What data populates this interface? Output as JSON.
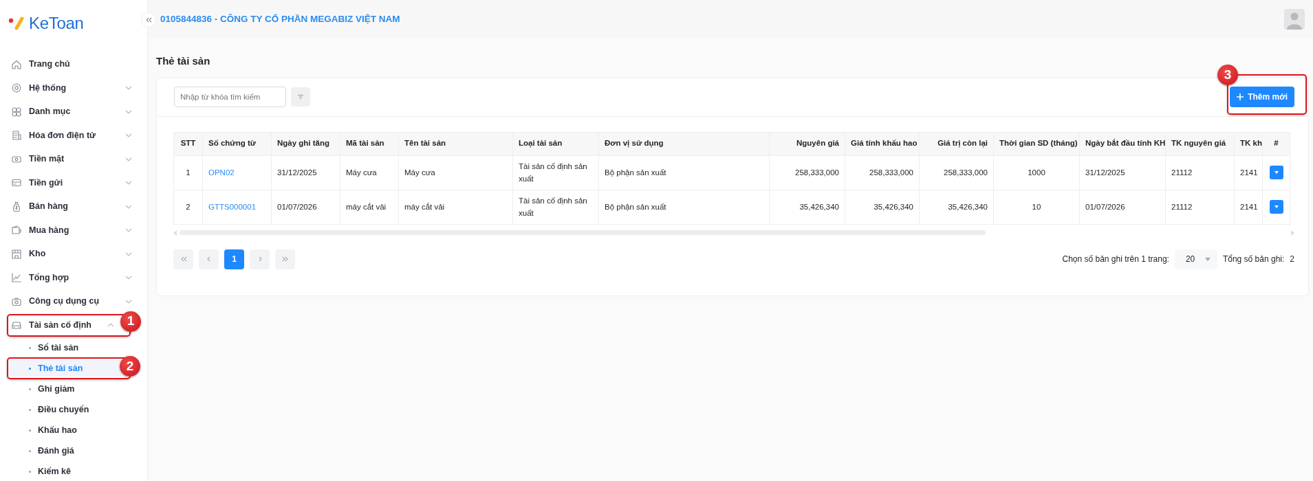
{
  "logo": {
    "text": "KeToan"
  },
  "sidebar": {
    "items": [
      {
        "label": "Trang chủ"
      },
      {
        "label": "Hệ thống",
        "expanded": false
      },
      {
        "label": "Danh mục",
        "expanded": false
      },
      {
        "label": "Hóa đơn điện tử",
        "expanded": false
      },
      {
        "label": "Tiền mặt",
        "expanded": false
      },
      {
        "label": "Tiền gửi",
        "expanded": false
      },
      {
        "label": "Bán hàng",
        "expanded": false
      },
      {
        "label": "Mua hàng",
        "expanded": false
      },
      {
        "label": "Kho",
        "expanded": false
      },
      {
        "label": "Tổng hợp",
        "expanded": false
      },
      {
        "label": "Công cụ dụng cụ",
        "expanded": false
      },
      {
        "label": "Tài sản cố định",
        "expanded": true,
        "annotation": "1",
        "children": [
          {
            "label": "Sổ tài sản",
            "selected": false
          },
          {
            "label": "Thẻ tài sản",
            "selected": true,
            "annotation": "2"
          },
          {
            "label": "Ghi giảm",
            "selected": false
          },
          {
            "label": "Điều chuyển",
            "selected": false
          },
          {
            "label": "Khấu hao",
            "selected": false
          },
          {
            "label": "Đánh giá",
            "selected": false
          },
          {
            "label": "Kiểm kê",
            "selected": false
          }
        ]
      }
    ]
  },
  "header": {
    "company": "0105844836 - CÔNG TY CỔ PHẦN MEGABIZ VIỆT NAM"
  },
  "page_title": "Thẻ tài sản",
  "search": {
    "placeholder": "Nhập từ khóa tìm kiếm"
  },
  "add_button": {
    "label": "Thêm mới",
    "annotation": "3"
  },
  "table": {
    "columns": [
      "STT",
      "Số chứng từ",
      "Ngày ghi tăng",
      "Mã tài sản",
      "Tên tài sản",
      "Loại tài sản",
      "Đơn vị sử dụng",
      "Nguyên giá",
      "Giá tính khấu hao",
      "Giá trị còn lại",
      "Thời gian SD (tháng)",
      "Ngày bắt đầu tính KH",
      "TK nguyên giá",
      "TK kh",
      "#"
    ],
    "rows": [
      {
        "cells": [
          "1",
          "OPN02",
          "31/12/2025",
          "Máy cưa",
          "Máy cưa",
          "Tài sản cố định sản xuất",
          "Bộ phận sản xuất",
          "258,333,000",
          "258,333,000",
          "258,333,000",
          "1000",
          "31/12/2025",
          "21112",
          "2141"
        ]
      },
      {
        "cells": [
          "2",
          "GTTS000001",
          "01/07/2026",
          "máy cắt vải",
          "máy cắt vải",
          "Tài sản cố định sản xuất",
          "Bộ phận sản xuất",
          "35,426,340",
          "35,426,340",
          "35,426,340",
          "10",
          "01/07/2026",
          "21112",
          "2141"
        ]
      }
    ]
  },
  "pagination": {
    "pages": [
      {
        "label": "1",
        "selected": true
      }
    ],
    "page_size_label": "Chọn số bản ghi trên 1 trang:",
    "page_size": "20",
    "total_label": "Tổng số bản ghi:",
    "total": "2"
  }
}
